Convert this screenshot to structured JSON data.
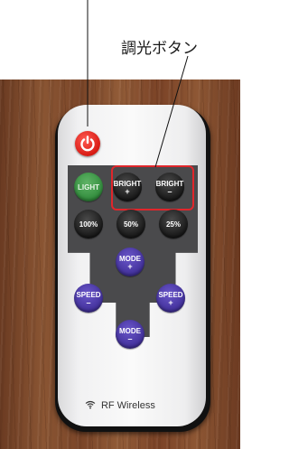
{
  "annotation": {
    "callout_text": "調光ボタン",
    "highlight_color": "#e0262b"
  },
  "remote": {
    "power_icon": "power-icon",
    "power_color": "#e01f1a",
    "buttons": {
      "light": "LIGHT",
      "bright_plus": {
        "label": "BRIGHT",
        "sign": "+"
      },
      "bright_minus": {
        "label": "BRIGHT",
        "sign": "–"
      },
      "p100": "100%",
      "p50": "50%",
      "p25": "25%",
      "mode_plus": {
        "label": "MODE",
        "sign": "+"
      },
      "mode_minus": {
        "label": "MODE",
        "sign": "–"
      },
      "speed_minus": {
        "label": "SPEED",
        "sign": "–"
      },
      "speed_plus": {
        "label": "SPEED",
        "sign": "+"
      }
    },
    "brand_icon": "wireless-icon",
    "brand_text": "RF Wireless"
  }
}
